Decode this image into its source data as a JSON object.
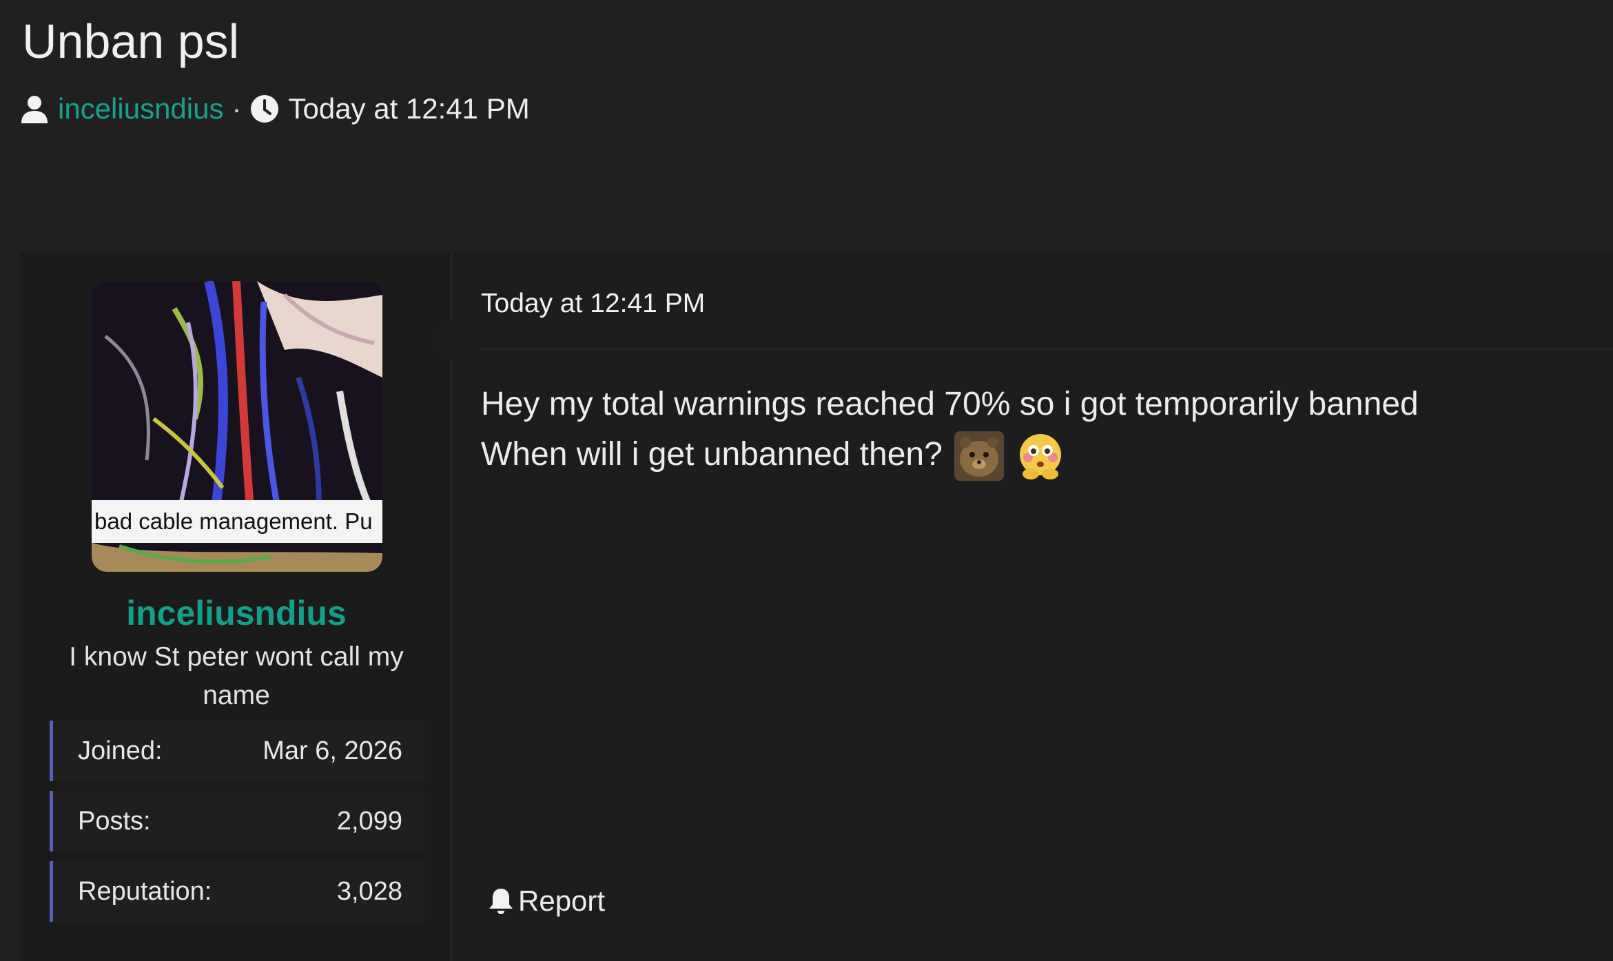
{
  "thread": {
    "title": "Unban psl",
    "author": "inceliusndius",
    "separator": "·",
    "time": "Today at 12:41 PM"
  },
  "poster": {
    "avatar_caption": "bad cable management. Pu",
    "name": "inceliusndius",
    "user_title": "I know St peter wont call my name",
    "stats": [
      {
        "label": "Joined:",
        "value": "Mar 6, 2026"
      },
      {
        "label": "Posts:",
        "value": "2,099"
      },
      {
        "label": "Reputation:",
        "value": "3,028"
      }
    ]
  },
  "post": {
    "date": "Today at 12:41 PM",
    "line1": "Hey my total warnings reached 70% so i got temporarily banned",
    "line2": "When will i get unbanned then?",
    "emojis": [
      "hamster-face-emoji",
      "flushed-hands-emoji"
    ],
    "report_label": "Report"
  },
  "colors": {
    "background": "#202020",
    "accent_teal": "#12a08b",
    "stat_border": "#5b5fb8"
  }
}
